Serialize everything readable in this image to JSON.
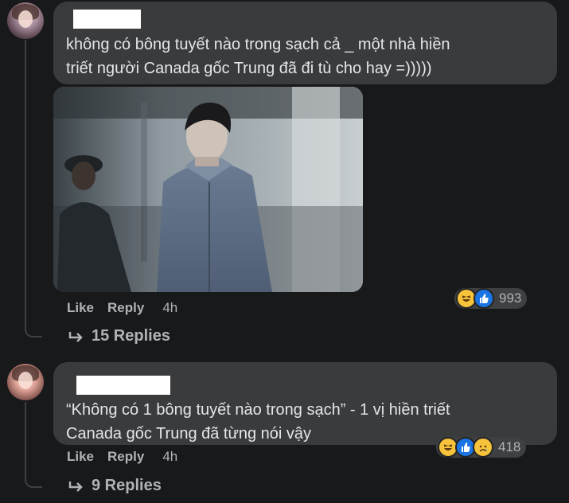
{
  "comments": [
    {
      "text_line1": "không có bông tuyết nào trong sạch cả _ một nhà hiền",
      "text_line2": "triết người Canada gốc Trung đã đi tù cho hay =)))))",
      "actions": {
        "like": "Like",
        "reply": "Reply",
        "time": "4h"
      },
      "reaction_count": "993",
      "reaction_icons": [
        "haha-icon",
        "like-icon"
      ],
      "replies_label": "15 Replies"
    },
    {
      "text_line1": "“Không có 1 bông tuyết nào trong sạch” - 1 vị hiền triết",
      "text_line2": "Canada gốc Trung đã từng nói vậy",
      "actions": {
        "like": "Like",
        "reply": "Reply",
        "time": "4h"
      },
      "reaction_count": "418",
      "reaction_icons": [
        "haha-icon",
        "like-icon",
        "sad-icon"
      ],
      "replies_label": "9 Replies"
    }
  ],
  "colors": {
    "background": "#18191a",
    "bubble": "#3a3b3c",
    "text": "#e4e6eb",
    "secondary": "#b0b3b8",
    "like_blue": "#1b74e4",
    "reaction_yellow": "#f7c33b"
  }
}
